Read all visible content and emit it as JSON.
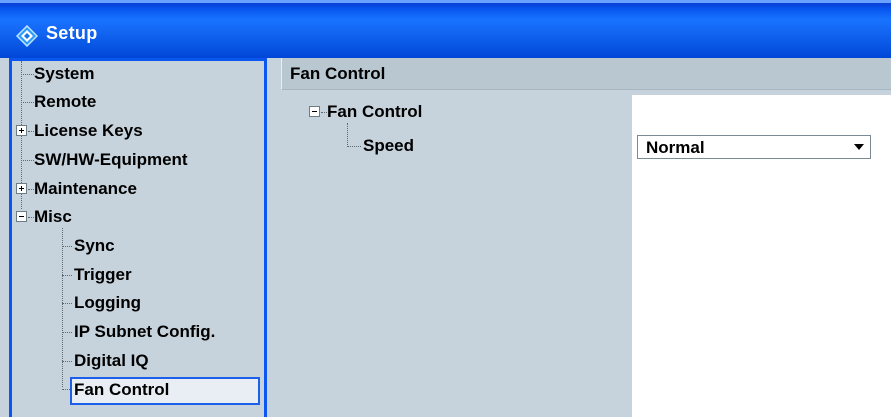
{
  "window": {
    "title": "Setup",
    "icon": "rs-diamond-icon"
  },
  "tree": {
    "items": [
      {
        "label": "System",
        "level": 0,
        "expander": "none"
      },
      {
        "label": "Remote",
        "level": 0,
        "expander": "none"
      },
      {
        "label": "License Keys",
        "level": 0,
        "expander": "plus"
      },
      {
        "label": "SW/HW-Equipment",
        "level": 0,
        "expander": "none"
      },
      {
        "label": "Maintenance",
        "level": 0,
        "expander": "plus"
      },
      {
        "label": "Misc",
        "level": 0,
        "expander": "minus"
      },
      {
        "label": "Sync",
        "level": 1,
        "expander": "none"
      },
      {
        "label": "Trigger",
        "level": 1,
        "expander": "none"
      },
      {
        "label": "Logging",
        "level": 1,
        "expander": "none"
      },
      {
        "label": "IP Subnet Config.",
        "level": 1,
        "expander": "none"
      },
      {
        "label": "Digital IQ",
        "level": 1,
        "expander": "none"
      },
      {
        "label": "Fan Control",
        "level": 1,
        "expander": "none",
        "selected": true
      }
    ]
  },
  "panel": {
    "header": "Fan Control",
    "group_label": "Fan Control",
    "param_label": "Speed",
    "param_value": "Normal"
  },
  "colors": {
    "titlebar": "#0a5af0",
    "selection_border": "#1c5fe8",
    "panel_bg": "#c7d3dc"
  }
}
